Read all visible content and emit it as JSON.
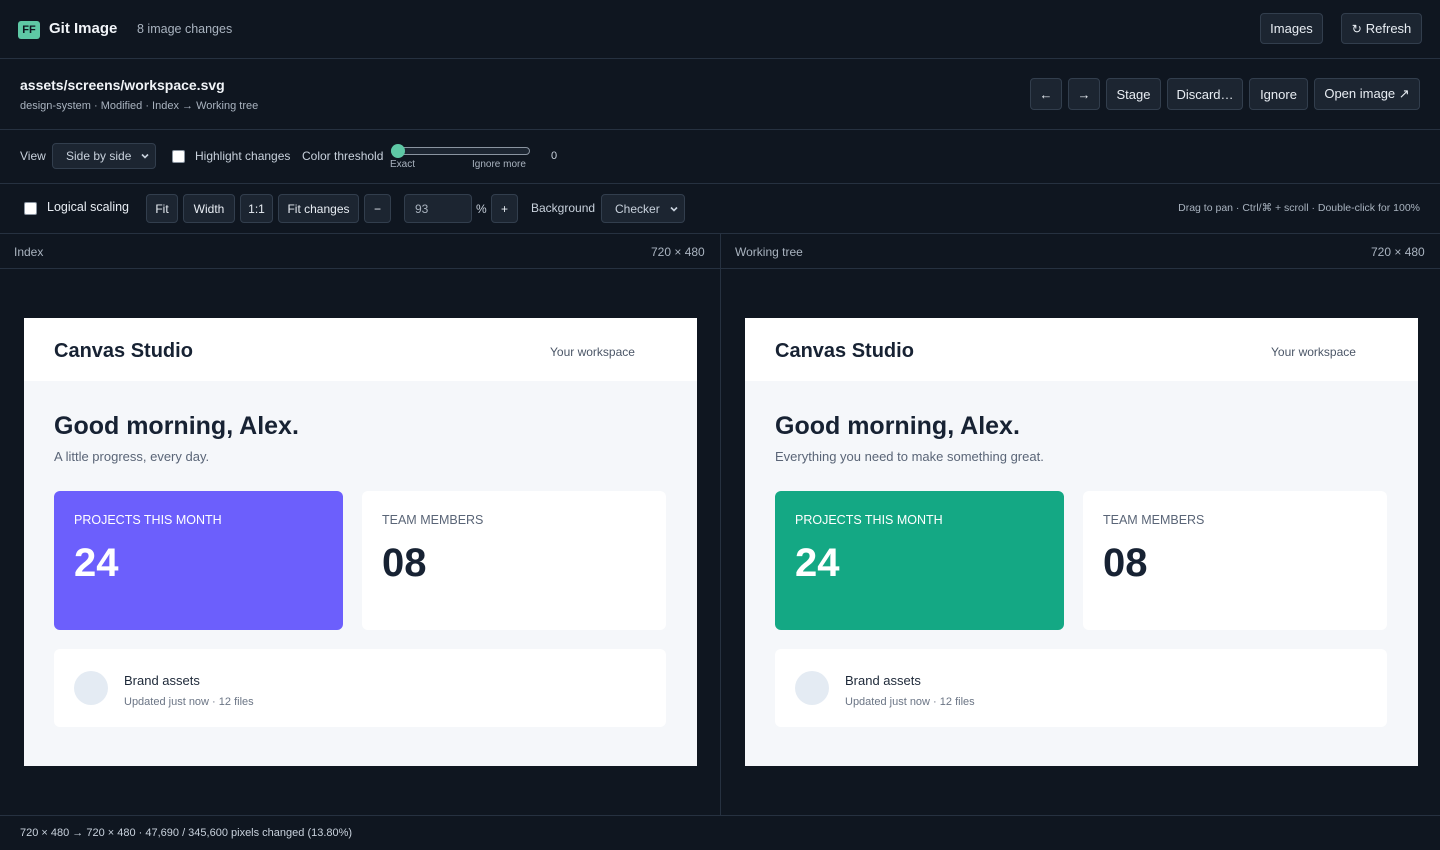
{
  "app": {
    "logo_text": "FF",
    "title": "Git Image",
    "changes": "8 image changes",
    "images_button": "Images",
    "refresh_button": "Refresh"
  },
  "file": {
    "path": "assets/screens/workspace.svg",
    "meta": "design-system · Modified · Index → Working tree",
    "prev_arrow": "←",
    "next_arrow": "→",
    "stage": "Stage",
    "discard": "Discard…",
    "ignore": "Ignore",
    "open_image": "Open image ↗"
  },
  "view_bar": {
    "view_label": "View",
    "view_value": "Side by side",
    "highlight_label": "Highlight changes",
    "threshold_label": "Color threshold",
    "threshold_min_label": "Exact",
    "threshold_max_label": "Ignore more",
    "threshold_value": "0",
    "threshold_fraction": 0
  },
  "zoom_bar": {
    "logical_label": "Logical scaling",
    "fit": "Fit",
    "width": "Width",
    "one_to_one": "1:1",
    "fit_changes": "Fit changes",
    "minus": "−",
    "zoom_value": "93",
    "percent": "%",
    "plus": "+",
    "background_label": "Background",
    "background_value": "Checker",
    "hint": "Drag to pan · Ctrl/⌘ + scroll · Double-click for 100%"
  },
  "panes": {
    "left": {
      "label": "Index",
      "size": "720 × 480"
    },
    "right": {
      "label": "Working tree",
      "size": "720 × 480"
    }
  },
  "mock_left": {
    "brand": "Canvas Studio",
    "workspace": "Your workspace",
    "greeting": "Good morning, Alex.",
    "subtitle": "A little progress, every day.",
    "card1_label": "PROJECTS THIS MONTH",
    "card1_value": "24",
    "card2_label": "TEAM MEMBERS",
    "card2_value": "08",
    "row_title": "Brand assets",
    "row_meta": "Updated just now · 12 files"
  },
  "mock_right": {
    "brand": "Canvas Studio",
    "workspace": "Your workspace",
    "greeting": "Good morning, Alex.",
    "subtitle": "Everything you need to make something great.",
    "card1_label": "PROJECTS THIS MONTH",
    "card1_value": "24",
    "card2_label": "TEAM MEMBERS",
    "card2_value": "08",
    "row_title": "Brand assets",
    "row_meta": "Updated just now · 12 files"
  },
  "status": "720 × 480 → 720 × 480 · 47,690 / 345,600 pixels changed (13.80%)",
  "colors": {
    "accent": "#5ec8a5",
    "left_card": "#6c5ffc",
    "right_card": "#14a884",
    "background": "#0f1620"
  }
}
